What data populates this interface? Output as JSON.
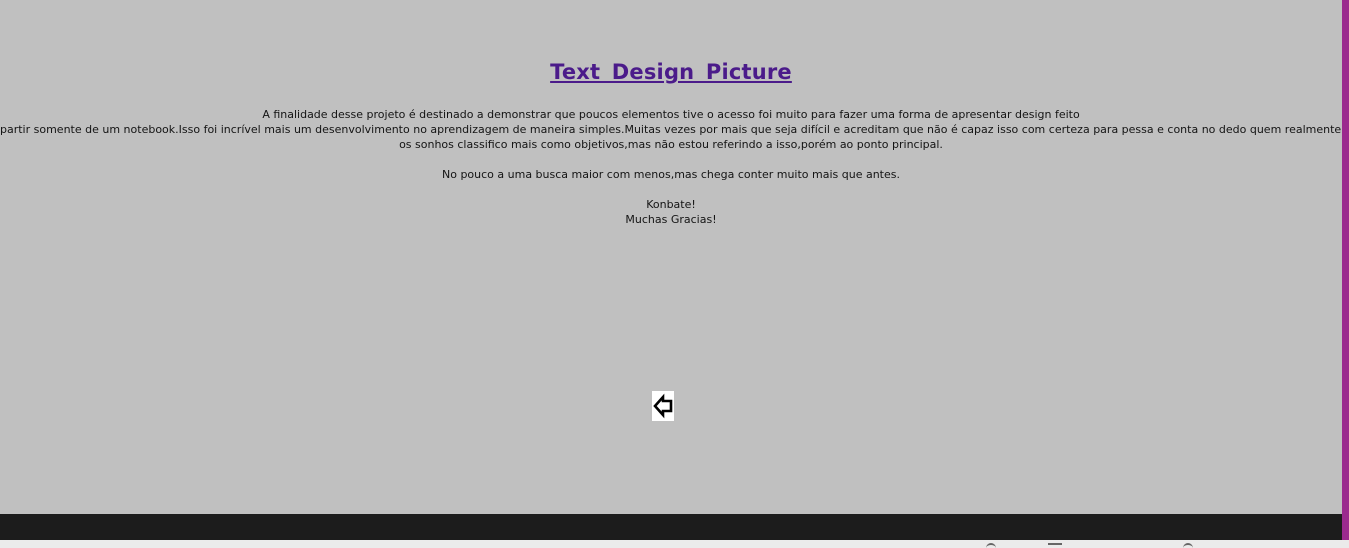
{
  "page": {
    "title": "Text  Design  Picture",
    "paragraph_lines": [
      "A finalidade desse projeto é destinado a demonstrar que poucos elementos tive o acesso foi muito para fazer uma forma de apresentar design feito",
      "partir somente de um notebook.Isso foi incrível mais um desenvolvimento no aprendizagem de maneira simples.Muitas vezes por mais que seja difícil e acreditam que não é capaz isso com certeza para pessa e conta no dedo quem realmente está junto são poucos em atingir",
      "os sonhos classifico mais como objetivos,mas não estou referindo a isso,porém ao ponto principal."
    ],
    "paragraph2": "No pouco a uma busca maior com menos,mas chega conter muito mais que antes.",
    "sign_line1": "Konbate!",
    "sign_line2": "Muchas Gracias!"
  },
  "back_button": {
    "icon": "back-arrow-icon"
  },
  "colors": {
    "page_background": "#c0c0c0",
    "title": "#4b1b8a",
    "scrollbar_accent": "#9b2a8e",
    "taskbar": "#1c1c1c"
  }
}
